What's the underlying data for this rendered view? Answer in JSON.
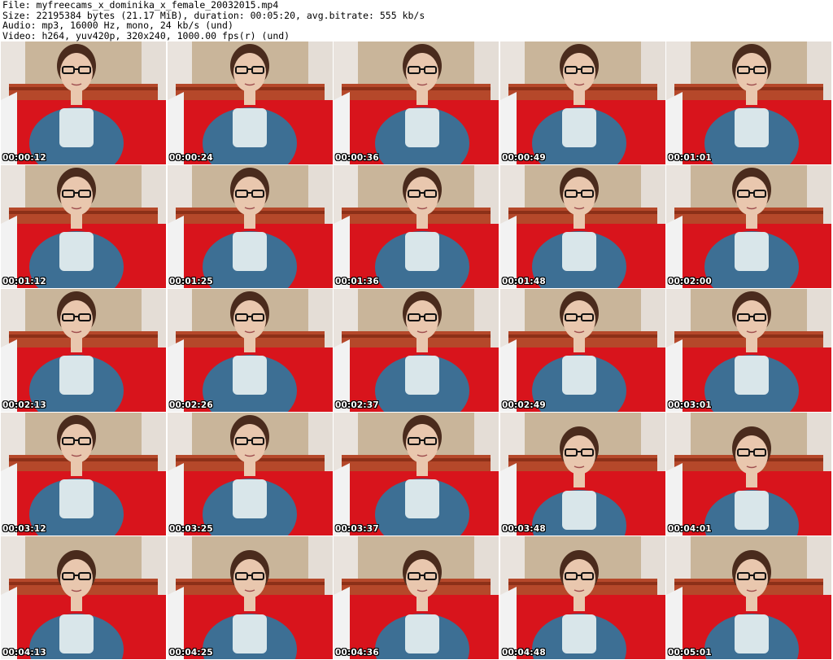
{
  "header": {
    "file_line": "File: myfreecams_x_dominika_x_female_20032015.mp4",
    "size_line": "Size: 22195384 bytes (21.17 MiB), duration: 00:05:20, avg.bitrate: 555 kb/s",
    "audio_line": "Audio: mp3, 16000 Hz, mono, 24 kb/s (und)",
    "video_line": "Video: h264, yuv420p, 320x240, 1000.00 fps(r) (und)"
  },
  "thumbnails": [
    {
      "timestamp": "00:00:12"
    },
    {
      "timestamp": "00:00:24"
    },
    {
      "timestamp": "00:00:36"
    },
    {
      "timestamp": "00:00:49"
    },
    {
      "timestamp": "00:01:01"
    },
    {
      "timestamp": "00:01:12"
    },
    {
      "timestamp": "00:01:25"
    },
    {
      "timestamp": "00:01:36"
    },
    {
      "timestamp": "00:01:48"
    },
    {
      "timestamp": "00:02:00"
    },
    {
      "timestamp": "00:02:13"
    },
    {
      "timestamp": "00:02:26"
    },
    {
      "timestamp": "00:02:37"
    },
    {
      "timestamp": "00:02:49"
    },
    {
      "timestamp": "00:03:01"
    },
    {
      "timestamp": "00:03:12"
    },
    {
      "timestamp": "00:03:25"
    },
    {
      "timestamp": "00:03:37"
    },
    {
      "timestamp": "00:03:48"
    },
    {
      "timestamp": "00:04:01"
    },
    {
      "timestamp": "00:04:13"
    },
    {
      "timestamp": "00:04:25"
    },
    {
      "timestamp": "00:04:36"
    },
    {
      "timestamp": "00:04:48"
    },
    {
      "timestamp": "00:05:01"
    }
  ],
  "colors": {
    "background": "#ffffff",
    "wall": "#c9b59a",
    "bed_red": "#d8141c",
    "sweater": "#3d6f94",
    "skin": "#e9c7ae",
    "hair": "#4a2b1d",
    "headboard": "#b5482a"
  }
}
